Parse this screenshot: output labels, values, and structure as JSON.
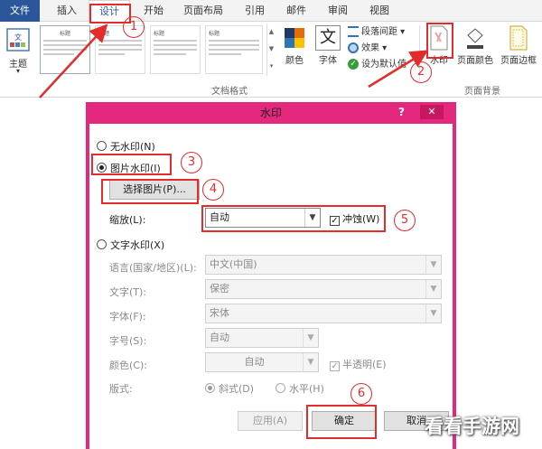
{
  "ribbon": {
    "tabs": [
      {
        "label": "文件"
      },
      {
        "label": "插入"
      },
      {
        "label": "设计"
      },
      {
        "label": "开始"
      },
      {
        "label": "页面布局"
      },
      {
        "label": "引用"
      },
      {
        "label": "邮件"
      },
      {
        "label": "审阅"
      },
      {
        "label": "视图"
      }
    ],
    "theme_label": "主题",
    "gallery_items": [
      {
        "title": "标题"
      },
      {
        "title": "标题"
      },
      {
        "title": "标题"
      },
      {
        "title": "标题"
      }
    ],
    "colors_label": "颜色",
    "fonts_label": "字体",
    "fonts_icon_text": "文",
    "paragraph_spacing_label": "段落间距",
    "effects_label": "效果",
    "set_default_label": "设为默认值",
    "doc_format_group": "文档格式",
    "watermark_label": "水印",
    "page_color_label": "页面颜色",
    "page_border_label": "页面边框",
    "page_bg_group": "页面背景"
  },
  "dialog": {
    "title": "水印",
    "help": "?",
    "close": "✕",
    "no_watermark": "无水印(N)",
    "picture_watermark": "图片水印(I)",
    "select_picture": "选择图片(P)...",
    "scale_label": "缩放(L):",
    "scale_value": "自动",
    "washout_label": "冲蚀(W)",
    "text_watermark": "文字水印(X)",
    "language_label": "语言(国家/地区)(L):",
    "language_value": "中文(中国)",
    "text_label": "文字(T):",
    "text_value": "保密",
    "font_label": "字体(F):",
    "font_value": "宋体",
    "size_label": "字号(S):",
    "size_value": "自动",
    "color_label": "颜色(C):",
    "color_value": "自动",
    "semitransparent_label": "半透明(E)",
    "layout_label": "版式:",
    "diagonal_label": "斜式(D)",
    "horizontal_label": "水平(H)",
    "apply": "应用(A)",
    "ok": "确定",
    "cancel": "取消"
  },
  "annotations": [
    "1",
    "2",
    "3",
    "4",
    "5",
    "6"
  ],
  "watermark_text": "看看手游网",
  "colors": {
    "accent_red": "#e32c2c",
    "dialog_border": "#e4287d",
    "word_blue": "#2b579a"
  }
}
